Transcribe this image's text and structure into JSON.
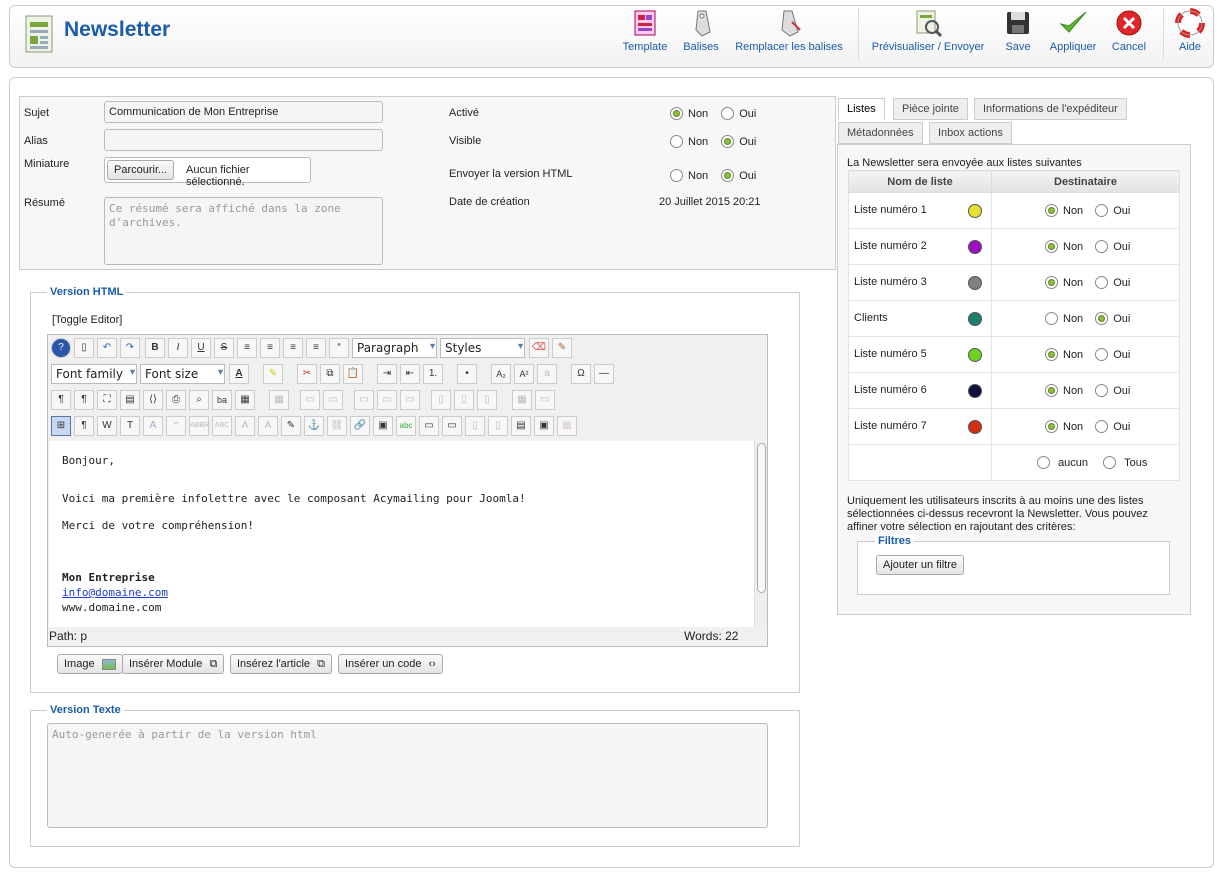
{
  "header": {
    "title": "Newsletter",
    "toolbar": [
      {
        "label": "Template",
        "icon": "template-icon"
      },
      {
        "label": "Balises",
        "icon": "tag-icon"
      },
      {
        "label": "Remplacer les balises",
        "icon": "replace-tag-icon"
      },
      {
        "label": "Prévisualiser / Envoyer",
        "icon": "preview-icon"
      },
      {
        "label": "Save",
        "icon": "save-icon"
      },
      {
        "label": "Appliquer",
        "icon": "check-icon"
      },
      {
        "label": "Cancel",
        "icon": "cancel-icon"
      },
      {
        "label": "Aide",
        "icon": "help-icon"
      }
    ]
  },
  "form": {
    "sujet_label": "Sujet",
    "sujet_value": "Communication de Mon Entreprise",
    "alias_label": "Alias",
    "alias_value": "",
    "miniature_label": "Miniature",
    "browse_label": "Parcourir...",
    "no_file": "Aucun fichier sélectionné.",
    "resume_label": "Résumé",
    "resume_placeholder": "Ce résumé sera affiché dans la zone d'archives.",
    "active_label": "Activé",
    "visible_label": "Visible",
    "html_label": "Envoyer la version HTML",
    "date_label": "Date de création",
    "date_value": "20 Juillet 2015 20:21",
    "non": "Non",
    "oui": "Oui",
    "active_value": "Non",
    "visible_value": "Oui",
    "html_value": "Oui"
  },
  "html_version": {
    "legend": "Version HTML",
    "toggle": "[Toggle Editor]",
    "paragraph": "Paragraph",
    "styles": "Styles",
    "font_family": "Font family",
    "font_size": "Font size",
    "content": {
      "greeting": "Bonjour,",
      "line1": "Voici ma première infolettre avec le composant Acymailing pour Joomla!",
      "line2": "Merci de votre compréhension!",
      "company": "Mon Entreprise",
      "email": "info@domaine.com",
      "website": "www.domaine.com"
    },
    "path": "Path: p",
    "words": "Words: 22",
    "buttons": [
      "Image",
      "Insérer Module",
      "Insérez l'article",
      "Insérer un code"
    ]
  },
  "text_version": {
    "legend": "Version Texte",
    "placeholder": "Auto-generée à partir de la version html"
  },
  "tabs": [
    "Listes",
    "Pièce jointe",
    "Informations de l'expéditeur",
    "Métadonnées",
    "Inbox actions"
  ],
  "lists_panel": {
    "intro": "La Newsletter sera envoyée aux listes suivantes",
    "col_name": "Nom de liste",
    "col_recipient": "Destinataire",
    "rows": [
      {
        "name": "Liste numéro 1",
        "color": "#e8e030",
        "value": "Non"
      },
      {
        "name": "Liste numéro 2",
        "color": "#9a10c0",
        "value": "Non"
      },
      {
        "name": "Liste numéro 3",
        "color": "#808080",
        "value": "Non"
      },
      {
        "name": "Clients",
        "color": "#1a7f70",
        "value": "Oui"
      },
      {
        "name": "Liste numéro 5",
        "color": "#70d020",
        "value": "Non"
      },
      {
        "name": "Liste numéro 6",
        "color": "#101040",
        "value": "Non"
      },
      {
        "name": "Liste numéro 7",
        "color": "#d03010",
        "value": "Non"
      }
    ],
    "aucun": "aucun",
    "tous": "Tous",
    "note": "Uniquement les utilisateurs inscrits à au moins une des listes sélectionnées ci-dessus recevront la Newsletter. Vous pouvez affiner votre sélection en rajoutant des critères:",
    "filters_legend": "Filtres",
    "add_filter": "Ajouter un filtre"
  }
}
